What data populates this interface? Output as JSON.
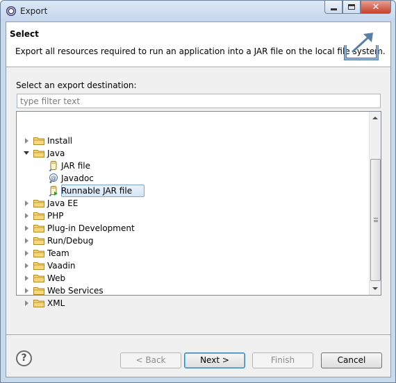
{
  "window": {
    "title": "Export",
    "icon": "eclipse-icon"
  },
  "banner": {
    "title": "Select",
    "description": "Export all resources required to run an application into a JAR file on the local file system.",
    "icon": "export-wizard-icon"
  },
  "destination": {
    "label": "Select an export destination:",
    "filter_placeholder": "type filter text",
    "filter_value": ""
  },
  "tree": {
    "items": [
      {
        "label": "Install",
        "level": 0,
        "expanded": false,
        "icon": "folder-icon"
      },
      {
        "label": "Java",
        "level": 0,
        "expanded": true,
        "icon": "folder-icon"
      },
      {
        "label": "JAR file",
        "level": 1,
        "icon": "jar-file-icon"
      },
      {
        "label": "Javadoc",
        "level": 1,
        "icon": "javadoc-icon"
      },
      {
        "label": "Runnable JAR file",
        "level": 1,
        "icon": "runnable-jar-icon",
        "selected": true
      },
      {
        "label": "Java EE",
        "level": 0,
        "expanded": false,
        "icon": "folder-icon"
      },
      {
        "label": "PHP",
        "level": 0,
        "expanded": false,
        "icon": "folder-icon"
      },
      {
        "label": "Plug-in Development",
        "level": 0,
        "expanded": false,
        "icon": "folder-icon"
      },
      {
        "label": "Run/Debug",
        "level": 0,
        "expanded": false,
        "icon": "folder-icon"
      },
      {
        "label": "Team",
        "level": 0,
        "expanded": false,
        "icon": "folder-icon"
      },
      {
        "label": "Vaadin",
        "level": 0,
        "expanded": false,
        "icon": "folder-icon"
      },
      {
        "label": "Web",
        "level": 0,
        "expanded": false,
        "icon": "folder-icon"
      },
      {
        "label": "Web Services",
        "level": 0,
        "expanded": false,
        "icon": "folder-icon"
      },
      {
        "label": "XML",
        "level": 0,
        "expanded": false,
        "icon": "folder-icon"
      }
    ]
  },
  "buttons": {
    "help": "?",
    "back": "< Back",
    "next": "Next >",
    "finish": "Finish",
    "cancel": "Cancel"
  },
  "colors": {
    "folder": "#e8c14a",
    "selection_border": "#7da2ce",
    "default_button_border": "#3c7fb1"
  }
}
